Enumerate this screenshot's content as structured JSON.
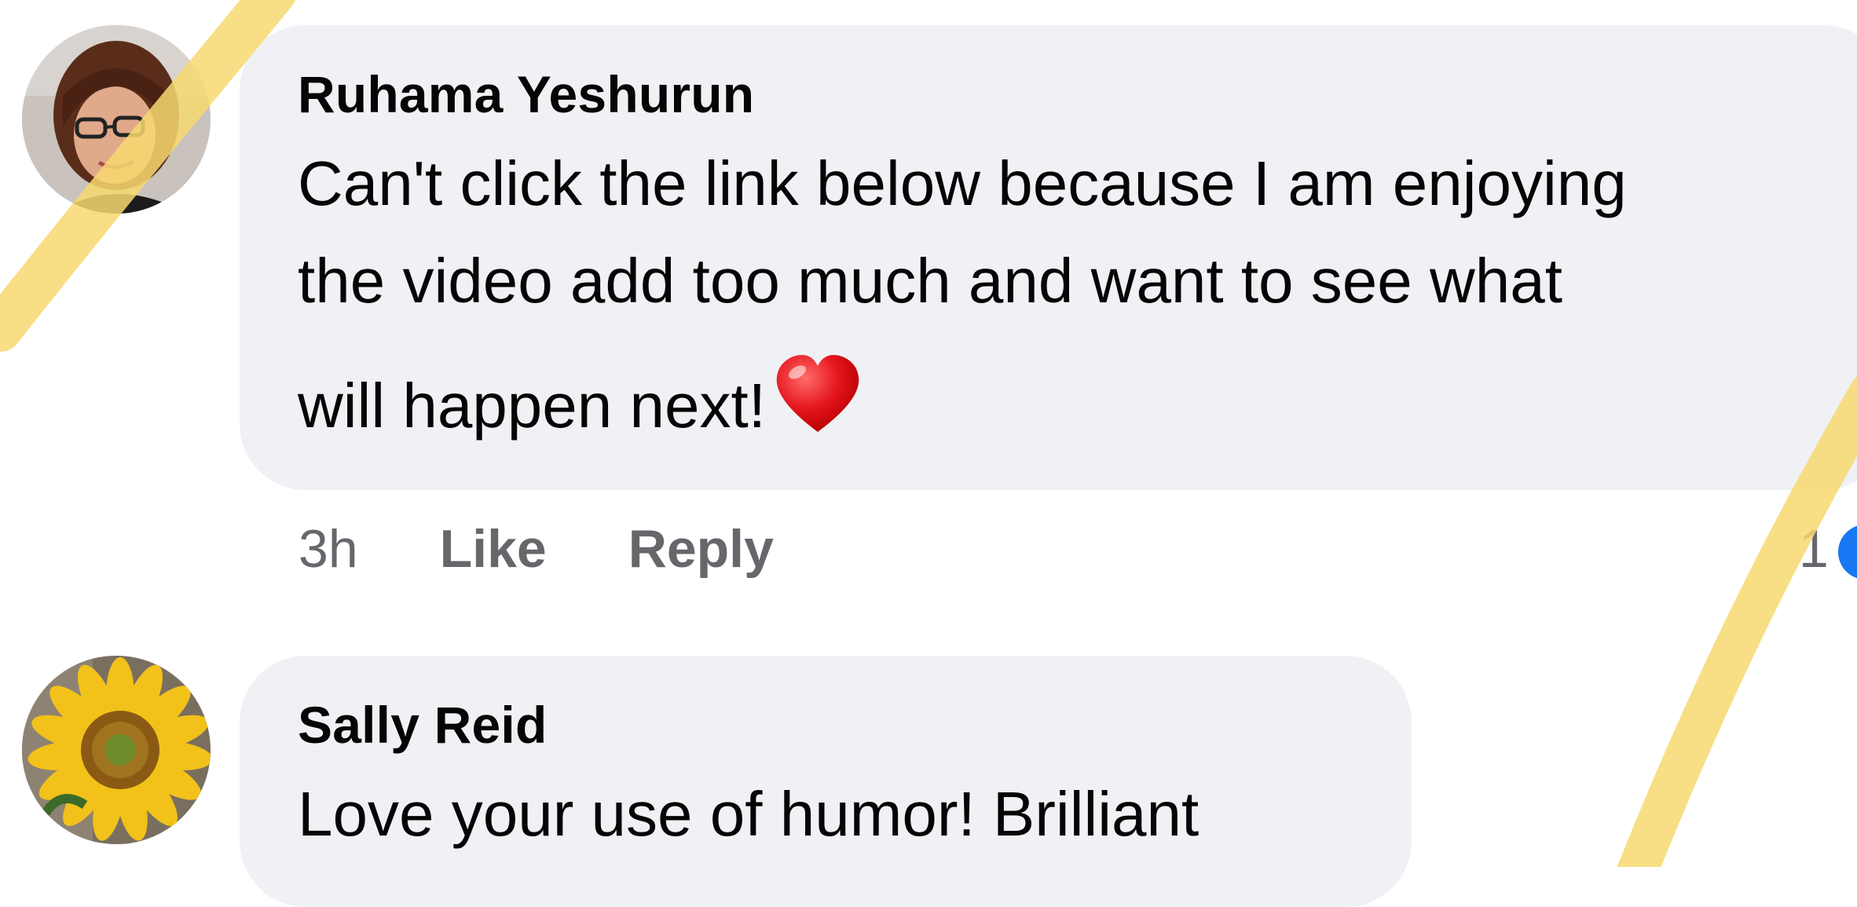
{
  "comments": [
    {
      "author": "Ruhama Yeshurun",
      "text_line1": "Can't click the link below because I am enjoying",
      "text_line2": "the video add too much and want to see what",
      "text_line3": "will happen next!",
      "emoji": "heart-icon",
      "time": "3h",
      "like_label": "Like",
      "reply_label": "Reply",
      "reaction_count": "1",
      "reaction_color": "#1877f2"
    },
    {
      "author": "Sally Reid",
      "text_line1": "Love your use of humor!  Brilliant"
    }
  ],
  "colors": {
    "bubble_bg": "#f0f1f5",
    "meta_text": "#65676b",
    "highlight": "#f7d970"
  }
}
